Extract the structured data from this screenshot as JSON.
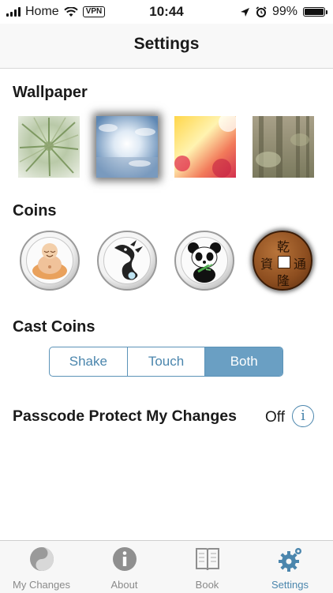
{
  "status_bar": {
    "carrier": "Home",
    "vpn": "VPN",
    "time": "10:44",
    "battery": "99%",
    "battery_level": 0.99
  },
  "nav": {
    "title": "Settings"
  },
  "wallpaper": {
    "title": "Wallpaper",
    "options": [
      "green-plant-wallpaper",
      "sky-light-wallpaper",
      "sunset-flowers-wallpaper",
      "forest-mist-wallpaper"
    ],
    "selected_index": 1
  },
  "coins": {
    "title": "Coins",
    "options": [
      "buddha-coin",
      "dragon-coin",
      "panda-coin",
      "chinese-bronze-coin"
    ],
    "bronze_chars": {
      "top": "乾",
      "left": "資",
      "right": "通",
      "bottom": "隆"
    }
  },
  "cast_coins": {
    "title": "Cast Coins",
    "options": [
      "Shake",
      "Touch",
      "Both"
    ],
    "selected": "Both"
  },
  "passcode": {
    "label": "Passcode Protect My Changes",
    "value": "Off"
  },
  "tabs": [
    {
      "label": "My Changes",
      "icon": "yin-yang-icon"
    },
    {
      "label": "About",
      "icon": "info-icon"
    },
    {
      "label": "Book",
      "icon": "book-icon"
    },
    {
      "label": "Settings",
      "icon": "gear-icon",
      "active": true
    }
  ],
  "colors": {
    "accent": "#4b86ad",
    "segment_selected": "#6a9fc3"
  }
}
